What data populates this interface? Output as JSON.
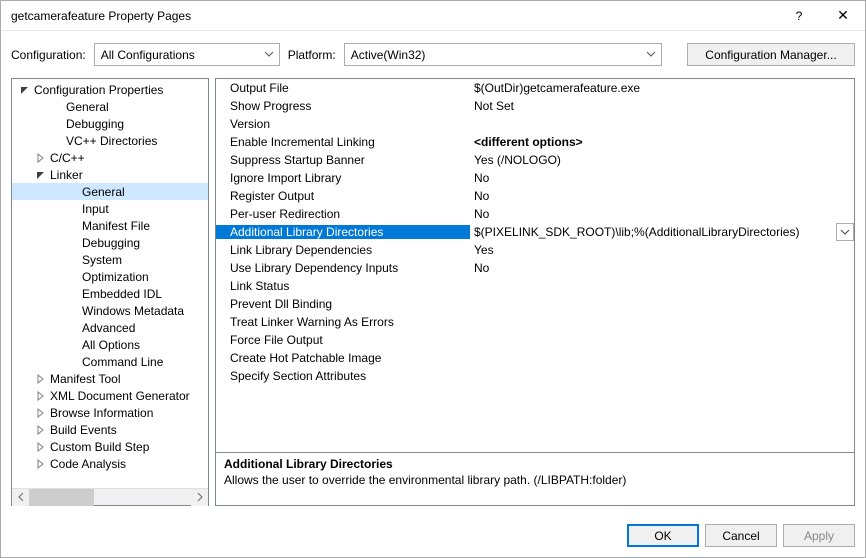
{
  "window": {
    "title": "getcamerafeature Property Pages"
  },
  "toolbar": {
    "config_label": "Configuration:",
    "config_value": "All Configurations",
    "platform_label": "Platform:",
    "platform_value": "Active(Win32)",
    "config_manager": "Configuration Manager..."
  },
  "tree": {
    "root": "Configuration Properties",
    "items_top": [
      "General",
      "Debugging",
      "VC++ Directories"
    ],
    "cxx": "C/C++",
    "linker": "Linker",
    "linker_children": [
      "General",
      "Input",
      "Manifest File",
      "Debugging",
      "System",
      "Optimization",
      "Embedded IDL",
      "Windows Metadata",
      "Advanced",
      "All Options",
      "Command Line"
    ],
    "items_bottom": [
      "Manifest Tool",
      "XML Document Generator",
      "Browse Information",
      "Build Events",
      "Custom Build Step",
      "Code Analysis"
    ]
  },
  "props": [
    {
      "name": "Output File",
      "value": "$(OutDir)getcamerafeature.exe"
    },
    {
      "name": "Show Progress",
      "value": "Not Set"
    },
    {
      "name": "Version",
      "value": ""
    },
    {
      "name": "Enable Incremental Linking",
      "value": "<different options>",
      "bold": true
    },
    {
      "name": "Suppress Startup Banner",
      "value": "Yes (/NOLOGO)"
    },
    {
      "name": "Ignore Import Library",
      "value": "No"
    },
    {
      "name": "Register Output",
      "value": "No"
    },
    {
      "name": "Per-user Redirection",
      "value": "No"
    },
    {
      "name": "Additional Library Directories",
      "value": "$(PIXELINK_SDK_ROOT)\\lib;%(AdditionalLibraryDirectories)",
      "selected": true,
      "dropdown": true
    },
    {
      "name": "Link Library Dependencies",
      "value": "Yes"
    },
    {
      "name": "Use Library Dependency Inputs",
      "value": "No"
    },
    {
      "name": "Link Status",
      "value": ""
    },
    {
      "name": "Prevent Dll Binding",
      "value": ""
    },
    {
      "name": "Treat Linker Warning As Errors",
      "value": ""
    },
    {
      "name": "Force File Output",
      "value": ""
    },
    {
      "name": "Create Hot Patchable Image",
      "value": ""
    },
    {
      "name": "Specify Section Attributes",
      "value": ""
    }
  ],
  "description": {
    "title": "Additional Library Directories",
    "text": "Allows the user to override the environmental library path. (/LIBPATH:folder)"
  },
  "buttons": {
    "ok": "OK",
    "cancel": "Cancel",
    "apply": "Apply"
  }
}
